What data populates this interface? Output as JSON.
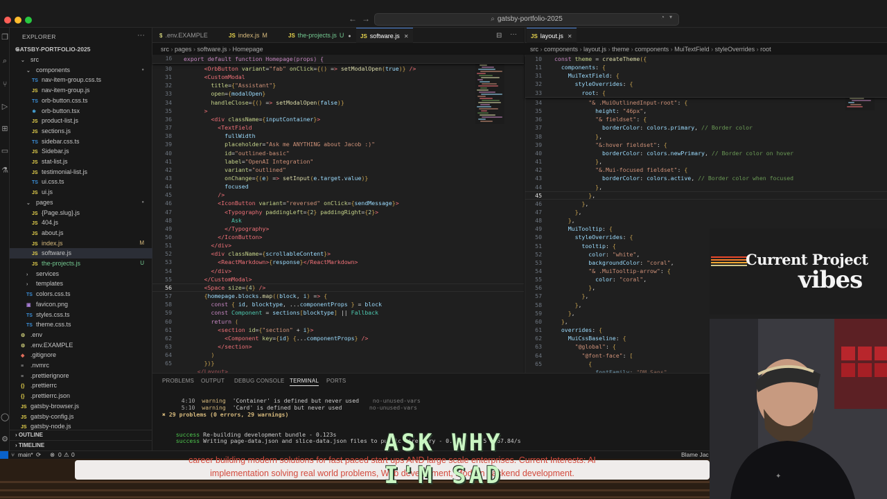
{
  "window": {
    "search_text": "gatsby-portfolio-2025"
  },
  "explorer": {
    "header": "EXPLORER",
    "root": "GATSBY-PORTFOLIO-2025",
    "tree": [
      {
        "label": "src",
        "kind": "folder-open",
        "indent": 1
      },
      {
        "label": "components",
        "kind": "folder-open",
        "indent": 2
      },
      {
        "label": "nav-item-group.css.ts",
        "kind": "ts",
        "indent": 3
      },
      {
        "label": "nav-item-group.js",
        "kind": "js",
        "indent": 3
      },
      {
        "label": "orb-button.css.ts",
        "kind": "ts",
        "indent": 3
      },
      {
        "label": "orb-button.tsx",
        "kind": "tsx",
        "indent": 3
      },
      {
        "label": "product-list.js",
        "kind": "js",
        "indent": 3
      },
      {
        "label": "sections.js",
        "kind": "js",
        "indent": 3
      },
      {
        "label": "sidebar.css.ts",
        "kind": "ts",
        "indent": 3
      },
      {
        "label": "Sidebar.js",
        "kind": "js",
        "indent": 3
      },
      {
        "label": "stat-list.js",
        "kind": "js",
        "indent": 3
      },
      {
        "label": "testimonial-list.js",
        "kind": "js",
        "indent": 3
      },
      {
        "label": "ui.css.ts",
        "kind": "ts",
        "indent": 3
      },
      {
        "label": "ui.js",
        "kind": "js",
        "indent": 3
      },
      {
        "label": "pages",
        "kind": "folder-open",
        "indent": 2
      },
      {
        "label": "{Page.slug}.js",
        "kind": "js",
        "indent": 3
      },
      {
        "label": "404.js",
        "kind": "js",
        "indent": 3
      },
      {
        "label": "about.js",
        "kind": "js",
        "indent": 3
      },
      {
        "label": "index.js",
        "kind": "js",
        "indent": 3,
        "badge": "M"
      },
      {
        "label": "software.js",
        "kind": "js",
        "indent": 3,
        "selected": true
      },
      {
        "label": "the-projects.js",
        "kind": "js",
        "indent": 3,
        "badge": "U"
      },
      {
        "label": "services",
        "kind": "folder",
        "indent": 2
      },
      {
        "label": "templates",
        "kind": "folder",
        "indent": 2
      },
      {
        "label": "colors.css.ts",
        "kind": "ts",
        "indent": 2
      },
      {
        "label": "favicon.png",
        "kind": "img",
        "indent": 2
      },
      {
        "label": "styles.css.ts",
        "kind": "ts",
        "indent": 2
      },
      {
        "label": "theme.css.ts",
        "kind": "ts",
        "indent": 2
      },
      {
        "label": ".env",
        "kind": "env",
        "indent": 1
      },
      {
        "label": ".env.EXAMPLE",
        "kind": "env",
        "indent": 1
      },
      {
        "label": ".gitignore",
        "kind": "git",
        "indent": 1
      },
      {
        "label": ".nvmrc",
        "kind": "file",
        "indent": 1
      },
      {
        "label": ".prettierignore",
        "kind": "file",
        "indent": 1
      },
      {
        "label": ".prettierrc",
        "kind": "json",
        "indent": 1
      },
      {
        "label": ".prettierrc.json",
        "kind": "json",
        "indent": 1
      },
      {
        "label": "gatsby-browser.js",
        "kind": "js",
        "indent": 1
      },
      {
        "label": "gatsby-config.js",
        "kind": "js",
        "indent": 1
      },
      {
        "label": "gatsby-node.js",
        "kind": "js",
        "indent": 1
      }
    ],
    "outline": "OUTLINE",
    "timeline": "TIMELINE"
  },
  "editor_left": {
    "tabs": [
      {
        "label": ".env.EXAMPLE",
        "icon": "$",
        "active": false
      },
      {
        "label": "index.js",
        "icon": "JS",
        "badge": "M",
        "active": false
      },
      {
        "label": "the-projects.js",
        "icon": "JS",
        "badge": "U",
        "active": false,
        "dirty": true
      },
      {
        "label": "software.js",
        "icon": "JS",
        "active": true
      }
    ],
    "breadcrumb": [
      "src",
      "pages",
      "software.js",
      "Homepage"
    ],
    "sticky_line": {
      "num": "16",
      "text": "export default function Homepage(props) {"
    },
    "lines": [
      {
        "n": "30",
        "code": "      <OrbButton variant=\"fab\" onClick={() => setModalOpen(true)} />"
      },
      {
        "n": "31",
        "code": "      <CustomModal"
      },
      {
        "n": "32",
        "code": "        title={\"Assistant\"}"
      },
      {
        "n": "33",
        "code": "        open={modalOpen}"
      },
      {
        "n": "34",
        "code": "        handleClose={() => setModalOpen(false)}"
      },
      {
        "n": "35",
        "code": "      >"
      },
      {
        "n": "36",
        "code": "        <div className={inputContainer}>"
      },
      {
        "n": "37",
        "code": "          <TextField"
      },
      {
        "n": "38",
        "code": "            fullWidth"
      },
      {
        "n": "39",
        "code": "            placeholder=\"Ask me ANYTHING about Jacob :)\""
      },
      {
        "n": "40",
        "code": "            id=\"outlined-basic\""
      },
      {
        "n": "41",
        "code": "            label=\"OpenAI Integration\""
      },
      {
        "n": "42",
        "code": "            variant=\"outlined\""
      },
      {
        "n": "43",
        "code": "            onChange={(e) => setInput(e.target.value)}"
      },
      {
        "n": "44",
        "code": "            focused"
      },
      {
        "n": "45",
        "code": "          />"
      },
      {
        "n": "46",
        "code": "          <IconButton variant=\"reversed\" onClick={sendMessage}>"
      },
      {
        "n": "47",
        "code": "            <Typography paddingLeft={2} paddingRight={2}>"
      },
      {
        "n": "48",
        "code": "              Ask"
      },
      {
        "n": "49",
        "code": "            </Typography>"
      },
      {
        "n": "50",
        "code": "          </IconButton>"
      },
      {
        "n": "51",
        "code": "        </div>"
      },
      {
        "n": "52",
        "code": "        <div className={scrollableContent}>"
      },
      {
        "n": "53",
        "code": "          <ReactMarkdown>{response}</ReactMarkdown>"
      },
      {
        "n": "54",
        "code": "        </div>"
      },
      {
        "n": "55",
        "code": "      </CustomModal>"
      },
      {
        "n": "56",
        "code": "      <Space size={4} />"
      },
      {
        "n": "57",
        "code": "      {homepage.blocks.map((block, i) => {"
      },
      {
        "n": "58",
        "code": "        const { id, blocktype, ...componentProps } = block"
      },
      {
        "n": "59",
        "code": "        const Component = sections[blocktype] || Fallback"
      },
      {
        "n": "60",
        "code": "        return ("
      },
      {
        "n": "61",
        "code": "          <section id={\"section\" + i}>"
      },
      {
        "n": "62",
        "code": "            <Component key={id} {...componentProps} />"
      },
      {
        "n": "63",
        "code": "          </section>"
      },
      {
        "n": "64",
        "code": "        )"
      },
      {
        "n": "65",
        "code": "      })}"
      }
    ],
    "current_line": "56",
    "partial_last": "    </Layout>"
  },
  "editor_right": {
    "tabs": [
      {
        "label": "layout.js",
        "icon": "JS",
        "active": true
      }
    ],
    "breadcrumb": [
      "src",
      "components",
      "layout.js",
      "theme",
      "components",
      "MuiTextField",
      "styleOverrides",
      "root"
    ],
    "sticky_lines": [
      {
        "n": "10",
        "code": "const theme = createTheme({"
      },
      {
        "n": "11",
        "code": "  components: {"
      },
      {
        "n": "31",
        "code": "    MuiTextField: {"
      },
      {
        "n": "32",
        "code": "      styleOverrides: {"
      },
      {
        "n": "33",
        "code": "        root: {"
      }
    ],
    "lines": [
      {
        "n": "34",
        "code": "          \"& .MuiOutlinedInput-root\": {"
      },
      {
        "n": "35",
        "code": "            height: \"46px\","
      },
      {
        "n": "36",
        "code": "            \"& fieldset\": {"
      },
      {
        "n": "37",
        "code": "              borderColor: colors.primary, // Border color"
      },
      {
        "n": "38",
        "code": "            },"
      },
      {
        "n": "39",
        "code": "            \"&:hover fieldset\": {"
      },
      {
        "n": "40",
        "code": "              borderColor: colors.newPrimary, // Border color on hover"
      },
      {
        "n": "41",
        "code": "            },"
      },
      {
        "n": "42",
        "code": "            \"&.Mui-focused fieldset\": {"
      },
      {
        "n": "43",
        "code": "              borderColor: colors.active, // Border color when focused"
      },
      {
        "n": "44",
        "code": "            },"
      },
      {
        "n": "45",
        "code": "          },"
      },
      {
        "n": "46",
        "code": "        },"
      },
      {
        "n": "47",
        "code": "      },"
      },
      {
        "n": "48",
        "code": "    },"
      },
      {
        "n": "49",
        "code": "    MuiTooltip: {"
      },
      {
        "n": "50",
        "code": "      styleOverrides: {"
      },
      {
        "n": "51",
        "code": "        tooltip: {"
      },
      {
        "n": "52",
        "code": "          color: \"white\","
      },
      {
        "n": "53",
        "code": "          backgroundColor: \"coral\","
      },
      {
        "n": "54",
        "code": "          \"& .MuiTooltip-arrow\": {"
      },
      {
        "n": "55",
        "code": "            color: \"coral\","
      },
      {
        "n": "56",
        "code": "          },"
      },
      {
        "n": "57",
        "code": "        },"
      },
      {
        "n": "58",
        "code": "      },"
      },
      {
        "n": "59",
        "code": "    },"
      },
      {
        "n": "60",
        "code": "  },"
      },
      {
        "n": "61",
        "code": "  overrides: {"
      },
      {
        "n": "62",
        "code": "    MuiCssBaseline: {"
      },
      {
        "n": "63",
        "code": "      \"@global\": {"
      },
      {
        "n": "64",
        "code": "        \"@font-face\": ["
      },
      {
        "n": "65",
        "code": "          {"
      }
    ],
    "current_line": "45",
    "partial_last": "            fontFamily: \"DM Sans\","
  },
  "panel": {
    "tabs": [
      "PROBLEMS",
      "OUTPUT",
      "DEBUG CONSOLE",
      "TERMINAL",
      "PORTS"
    ],
    "active_tab": "TERMINAL",
    "lines": [
      {
        "loc": "4:10",
        "level": "warning",
        "msg": "'Container' is defined but never used",
        "rule": "no-unused-vars"
      },
      {
        "loc": "5:10",
        "level": "warning",
        "msg": "'Card' is defined but never used",
        "rule": "no-unused-vars"
      }
    ],
    "summary": "✖ 29 problems (0 errors, 29 warnings)",
    "success1_label": "success",
    "success1_text": "Re-building development bundle - 0.123s",
    "success2_label": "success",
    "success2_text": "Writing page-data.json and slice-data.json files to public directory - 0.005s - 0/5 1067.84/s"
  },
  "statusbar": {
    "branch": "main*",
    "errors": "0",
    "warnings": "0",
    "right_text": "Blame Jac"
  },
  "website": {
    "line1": "career building modern solutions for fast paced start ups AND large scale enterprises. Current Interests: AI",
    "line2": "implementation solving real world problems, Web development, Modern backend development."
  },
  "captions": {
    "line1": "ASK WHY",
    "line2": "I'M SAD"
  },
  "overlay": {
    "line1": "Current Project",
    "line2": "vibes"
  },
  "colors": {
    "accent_blue": "#0a62c9",
    "warning_yellow": "#d7ba7d",
    "success_green": "#4ec94e",
    "error_red": "#ff5c57"
  }
}
